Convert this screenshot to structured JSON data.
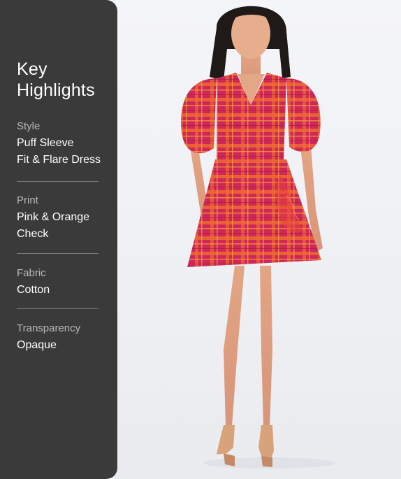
{
  "panel": {
    "title": "Key Highlights",
    "sections": [
      {
        "label": "Style",
        "value_lines": [
          "Puff Sleeve",
          "Fit & Flare Dress"
        ]
      },
      {
        "label": "Print",
        "value_lines": [
          "Pink & Orange",
          "Check"
        ]
      },
      {
        "label": "Fabric",
        "value_lines": [
          "Cotton"
        ]
      },
      {
        "label": "Transparency",
        "value_lines": [
          "Opaque"
        ]
      }
    ]
  },
  "colors": {
    "panel_bg": "#3a3a3a",
    "dress_pink": "#d2285a",
    "dress_orange": "#ee6a32"
  }
}
